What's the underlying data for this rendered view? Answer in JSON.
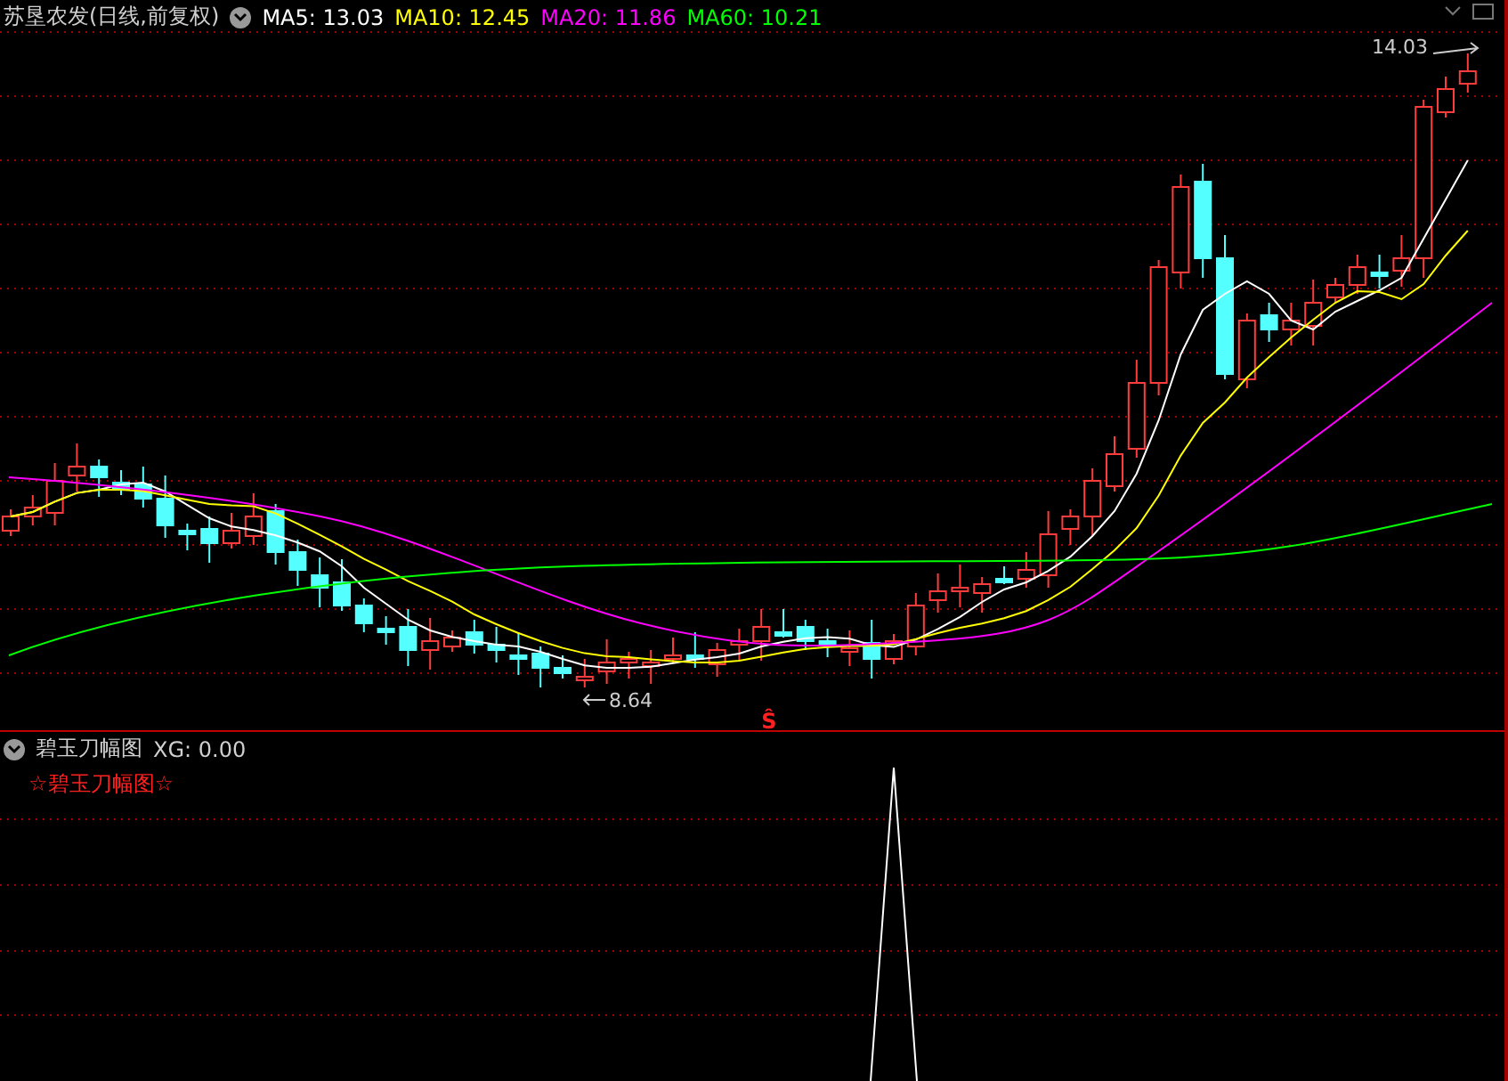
{
  "main_panel": {
    "title": "苏垦农发(日线,前复权)",
    "indicators": [
      {
        "label": "MA5: 13.03",
        "color": "#ffffff"
      },
      {
        "label": "MA10: 12.45",
        "color": "#ffff00"
      },
      {
        "label": "MA20: 11.86",
        "color": "#ff00ff"
      },
      {
        "label": "MA60: 10.21",
        "color": "#00ff00"
      }
    ],
    "high_label": "14.03",
    "low_label": "8.64",
    "signal_marker": "Ŝ"
  },
  "sub_panel": {
    "title": "碧玉刀幅图",
    "value": "XG: 0.00",
    "signal_name": "☆碧玉刀幅图☆"
  }
}
